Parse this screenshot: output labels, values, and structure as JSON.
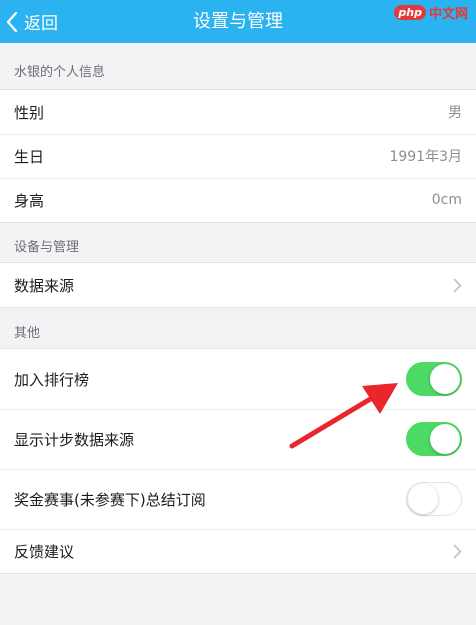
{
  "nav": {
    "back_label": "返回",
    "title": "设置与管理",
    "watermark_logo": "php",
    "watermark_text": "中文网"
  },
  "sections": {
    "personal": {
      "header": "水银的个人信息",
      "rows": [
        {
          "label": "性别",
          "value": "男"
        },
        {
          "label": "生日",
          "value": "1991年3月"
        },
        {
          "label": "身高",
          "value": "0cm"
        }
      ]
    },
    "device": {
      "header": "设备与管理",
      "rows": [
        {
          "label": "数据来源",
          "icon": "chevron-right-icon"
        }
      ]
    },
    "other": {
      "header": "其他",
      "rows": [
        {
          "label": "加入排行榜",
          "toggle": "on"
        },
        {
          "label": "显示计步数据来源",
          "toggle": "on"
        },
        {
          "label": "奖金赛事(未参赛下)总结订阅",
          "toggle": "off"
        },
        {
          "label": "反馈建议",
          "icon": "chevron-right-icon"
        }
      ]
    }
  },
  "colors": {
    "navbar": "#2ab3f0",
    "toggle_on": "#4cd964",
    "annotation_arrow": "#e8262b"
  }
}
